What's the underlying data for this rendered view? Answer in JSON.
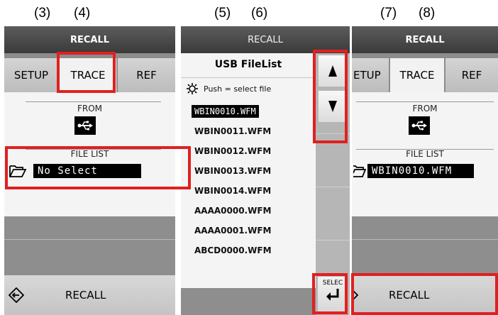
{
  "step_numbers": [
    "(3)",
    "(4)",
    "(5)",
    "(6)",
    "(7)",
    "(8)"
  ],
  "panel_left": {
    "title": "RECALL",
    "tabs": [
      "SETUP",
      "TRACE",
      "REF"
    ],
    "from_label": "FROM",
    "from_icon": "usb-icon",
    "file_list_label": "FILE LIST",
    "file_value": "No Select",
    "folder_icon": "folder-open-icon",
    "bottom_label": "RECALL",
    "bottom_icon": "recall-arrow-icon"
  },
  "panel_middle": {
    "title": "RECALL",
    "list_title": "USB FileList",
    "hint": "Push = select file",
    "hint_icon": "knob-icon",
    "files": [
      "WBIN0010.WFM",
      "WBIN0011.WFM",
      "WBIN0012.WFM",
      "WBIN0013.WFM",
      "WBIN0014.WFM",
      "AAAA0000.WFM",
      "AAAA0001.WFM",
      "ABCD0000.WFM"
    ],
    "selected_file": "WBIN0010.WFM",
    "up_icon": "arrow-up-icon",
    "down_icon": "arrow-down-icon",
    "select_label": "SELEC",
    "select_icon": "enter-icon"
  },
  "panel_right": {
    "title": "RECALL",
    "tabs": [
      "ETUP",
      "TRACE",
      "REF"
    ],
    "from_label": "FROM",
    "file_list_label": "FILE LIST",
    "file_value": "WBIN0010.WFM",
    "bottom_label": "RECALL"
  },
  "colors": {
    "highlight": "#e02020",
    "title_bar": "#3a3a3a",
    "panel_gray": "#8c8c8c",
    "field_bg": "#000000"
  }
}
